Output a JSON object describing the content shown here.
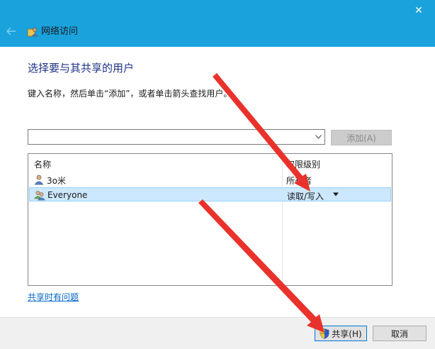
{
  "window": {
    "title": "网络访问",
    "close_glyph": "✕",
    "back_glyph": "←"
  },
  "heading": "选择要与其共享的用户",
  "instruction": "键入名称，然后单击“添加”，或者单击箭头查找用户。",
  "combo": {
    "value": ""
  },
  "add_button": {
    "label": "添加(A)"
  },
  "list": {
    "columns": [
      "名称",
      "权限级别"
    ],
    "rows": [
      {
        "name": "3o米",
        "permission": "所有者",
        "selected": false
      },
      {
        "name": "Everyone",
        "permission": "读取/写入",
        "selected": true
      }
    ]
  },
  "help_link": "共享时有问题",
  "footer": {
    "share_label": "共享(H)",
    "cancel_label": "取消"
  },
  "icons": {
    "title": "network-share-icon",
    "user": "user-icon",
    "group": "group-icon",
    "shield": "uac-shield-icon"
  },
  "colors": {
    "titlebar": "#1aa2dd",
    "heading": "#1e3287",
    "link": "#0066cc",
    "selection": "#cce8ff",
    "annotation_arrow": "#e8322b"
  }
}
